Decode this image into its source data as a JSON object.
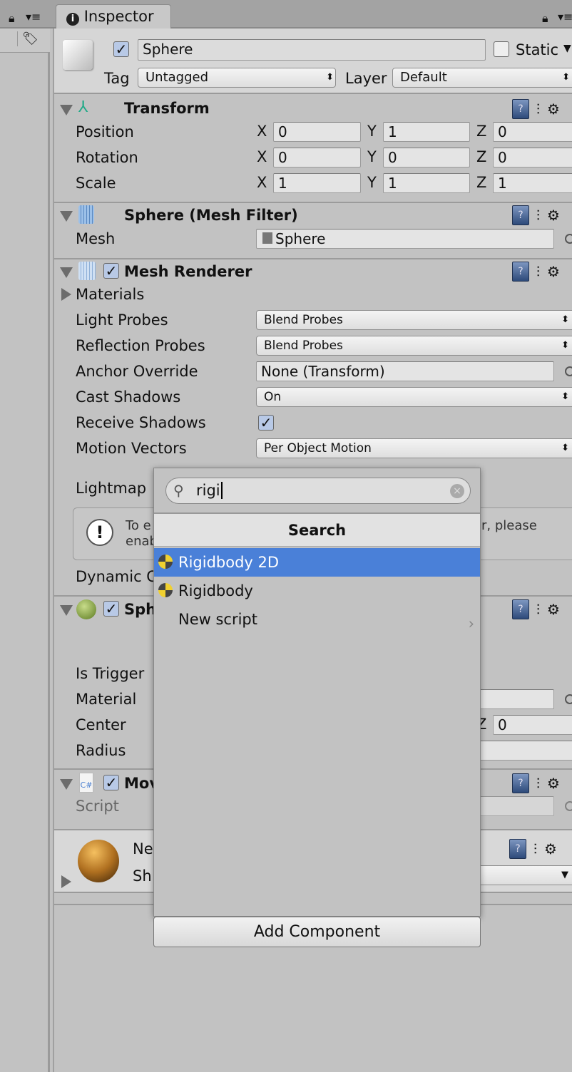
{
  "tab": {
    "title": "Inspector"
  },
  "object": {
    "name": "Sphere",
    "active": true,
    "static_label": "Static",
    "static": false,
    "tag_label": "Tag",
    "tag": "Untagged",
    "layer_label": "Layer",
    "layer": "Default"
  },
  "transform": {
    "title": "Transform",
    "rows": [
      {
        "label": "Position",
        "x": "0",
        "y": "1",
        "z": "0"
      },
      {
        "label": "Rotation",
        "x": "0",
        "y": "0",
        "z": "0"
      },
      {
        "label": "Scale",
        "x": "1",
        "y": "1",
        "z": "1"
      }
    ],
    "axis": {
      "x": "X",
      "y": "Y",
      "z": "Z"
    }
  },
  "mesh_filter": {
    "title": "Sphere (Mesh Filter)",
    "mesh_label": "Mesh",
    "mesh": "Sphere"
  },
  "mesh_renderer": {
    "title": "Mesh Renderer",
    "enabled": true,
    "materials": "Materials",
    "light_probes_label": "Light Probes",
    "light_probes": "Blend Probes",
    "reflection_label": "Reflection Probes",
    "reflection": "Blend Probes",
    "anchor_label": "Anchor Override",
    "anchor": "None (Transform)",
    "cast_label": "Cast Shadows",
    "cast": "On",
    "receive_label": "Receive Shadows",
    "receive": true,
    "motion_label": "Motion Vectors",
    "motion": "Per Object Motion",
    "lightmap_label": "Lightmap",
    "help_line1_a": "To e",
    "help_line1_b": "r, please",
    "help_line2": "enab",
    "dynamic_label": "Dynamic C"
  },
  "sphere_collider": {
    "title": "Sph",
    "enabled": true,
    "is_trigger": "Is Trigger",
    "material": "Material",
    "center": "Center",
    "center_z": "0",
    "z": "Z",
    "radius": "Radius"
  },
  "script_comp": {
    "title": "Mov",
    "enabled": true,
    "script_label": "Script",
    "icon_text": "C#"
  },
  "material_preview": {
    "name": "Ne",
    "shader": "Sh"
  },
  "add_component": {
    "search_value": "rigi",
    "header": "Search",
    "items": [
      {
        "label": "Rigidbody 2D",
        "selected": true,
        "icon": "rigidbody2d-icon"
      },
      {
        "label": "Rigidbody",
        "selected": false,
        "icon": "rigidbody-icon"
      },
      {
        "label": "New script",
        "selected": false,
        "icon": "chevron-right-icon"
      }
    ],
    "button": "Add Component",
    "highlight": "#4a80d8"
  }
}
